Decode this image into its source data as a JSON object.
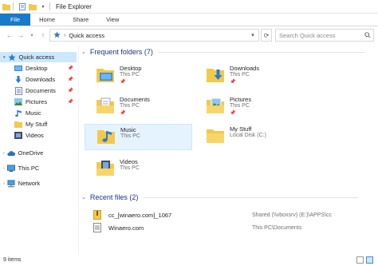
{
  "window": {
    "title": "File Explorer"
  },
  "ribbon": {
    "tabs": [
      {
        "label": "File"
      },
      {
        "label": "Home"
      },
      {
        "label": "Share"
      },
      {
        "label": "View"
      }
    ]
  },
  "address": {
    "path": "Quick access",
    "search_placeholder": "Search Quick access"
  },
  "nav": {
    "items": [
      {
        "label": "Quick access",
        "icon": "star-icon"
      },
      {
        "label": "Desktop",
        "icon": "desktop-folder-icon",
        "pinned": true
      },
      {
        "label": "Downloads",
        "icon": "download-folder-icon",
        "pinned": true
      },
      {
        "label": "Documents",
        "icon": "documents-folder-icon",
        "pinned": true
      },
      {
        "label": "Pictures",
        "icon": "pictures-folder-icon",
        "pinned": true
      },
      {
        "label": "Music",
        "icon": "music-folder-icon"
      },
      {
        "label": "My Stuff",
        "icon": "folder-icon"
      },
      {
        "label": "Videos",
        "icon": "videos-folder-icon"
      },
      {
        "label": "OneDrive",
        "icon": "cloud-icon"
      },
      {
        "label": "This PC",
        "icon": "computer-icon"
      },
      {
        "label": "Network",
        "icon": "network-icon"
      }
    ]
  },
  "frequent": {
    "title": "Frequent folders (7)",
    "folders": [
      {
        "name": "Desktop",
        "location": "This PC",
        "pinned": true
      },
      {
        "name": "Downloads",
        "location": "This PC",
        "pinned": true
      },
      {
        "name": "Documents",
        "location": "This PC",
        "pinned": true
      },
      {
        "name": "Pictures",
        "location": "This PC",
        "pinned": true
      },
      {
        "name": "Music",
        "location": "This PC",
        "pinned": false
      },
      {
        "name": "My Stuff",
        "location": "Local Disk (C:)",
        "pinned": false
      },
      {
        "name": "Videos",
        "location": "This PC",
        "pinned": false
      }
    ]
  },
  "recent": {
    "title": "Recent files (2)",
    "files": [
      {
        "name": "cc_[winaero.com]_1067",
        "path": "Shared (\\\\vboxsrv) (E:)\\APPS\\cc"
      },
      {
        "name": "Winaero.com",
        "path": "This PC\\Documents"
      }
    ]
  },
  "status": {
    "items_text": "9 items"
  },
  "colors": {
    "accent": "#1979ca",
    "folder": "#f3c94b",
    "selection": "#cce8ff",
    "heading": "#1e3287"
  }
}
